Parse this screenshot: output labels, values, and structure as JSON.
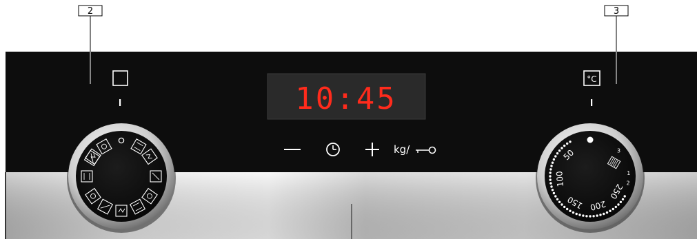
{
  "callouts": {
    "left_number": "2",
    "right_number": "3"
  },
  "display": {
    "time": "10:45",
    "color": "#ff2b1c"
  },
  "touch_controls": {
    "minus_symbol": "—",
    "plus_symbol": "+",
    "kg_label": "kg/"
  },
  "function_selector": {
    "off_marker": "o",
    "symbol_icons": [
      "hot-air-grill-icon",
      "light-icon",
      "top-bottom-heat-icon",
      "hot-air-eco-icon",
      "bottom-heat-icon",
      "intensive-heat-icon",
      "pizza-setting-icon",
      "full-surface-grill-icon",
      "circulated-air-grill-icon",
      "hot-air-icon",
      "3d-hot-air-icon",
      "defrost-icon"
    ]
  },
  "temperature_selector": {
    "unit_icon_text": "°C",
    "scale_labels": [
      "50",
      "100",
      "150",
      "200",
      "250"
    ],
    "grill_levels": [
      "1",
      "2",
      "3"
    ]
  },
  "colors": {
    "panel": "#0d0d0d",
    "steel_light": "#d6d6d6",
    "steel_dark": "#9a9a9a"
  }
}
